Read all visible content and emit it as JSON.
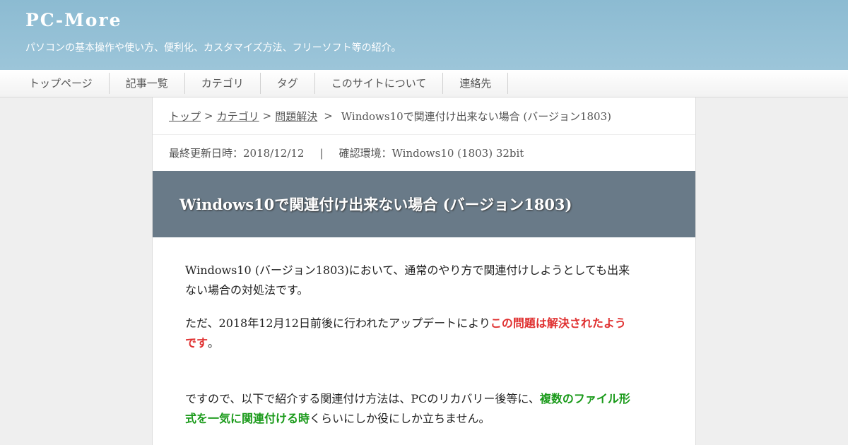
{
  "header": {
    "site_title": "PC-More",
    "site_description": "パソコンの基本操作や使い方、便利化、カスタマイズ方法、フリーソフト等の紹介。"
  },
  "nav": {
    "items": [
      {
        "label": "トップページ"
      },
      {
        "label": "記事一覧"
      },
      {
        "label": "カテゴリ"
      },
      {
        "label": "タグ"
      },
      {
        "label": "このサイトについて"
      },
      {
        "label": "連絡先"
      }
    ]
  },
  "breadcrumb": {
    "top": "トップ",
    "category": "カテゴリ",
    "section": "問題解決",
    "separator": ">",
    "current": "Windows10で関連付け出来ない場合 (バージョン1803)"
  },
  "meta": {
    "updated": "最終更新日時：2018/12/12",
    "divider": "|",
    "environment": "確認環境：Windows10 (1803) 32bit"
  },
  "article": {
    "title": "Windows10で関連付け出来ない場合 (バージョン1803)",
    "p1": "Windows10 (バージョン1803)において、通常のやり方で関連付けしようとしても出来ない場合の対処法です。",
    "p2_before": "ただ、2018年12月12日前後に行われたアップデートにより",
    "p2_highlight": "この問題は解決されたようです",
    "p2_after": "。",
    "p3_before": "ですので、以下で紹介する関連付け方法は、PCのリカバリー後等に、",
    "p3_highlight": "複数のファイル形式を一気に関連付ける時",
    "p3_after": "くらいにしか役にしか立ちません。"
  },
  "colors": {
    "header_bg": "#9cc5d9",
    "title_bar_bg": "#697a88",
    "highlight_red": "#e03131",
    "highlight_green": "#1a9a1a"
  }
}
